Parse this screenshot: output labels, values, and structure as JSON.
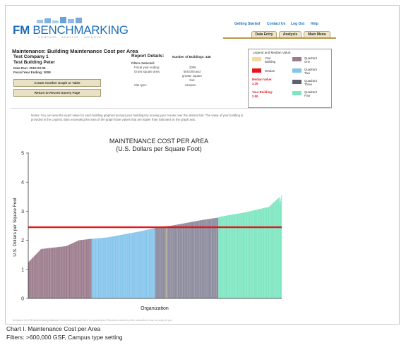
{
  "brand": {
    "fm": "FM",
    "benchmarking": "BENCHMARKING",
    "tagline": "COMPARE · ANALYZE · IMPROVE"
  },
  "topnav": [
    "Getting Started",
    "Contact Us",
    "Log Out",
    "Help"
  ],
  "tabs": [
    "Data Entry",
    "Analysis",
    "Main Menu"
  ],
  "page_title": "Maintenance: Building Maintenance Cost per Area",
  "company": "Test Company 1",
  "building": "Test Building Peter",
  "date_run": "Date Run: 2010-03-09",
  "fiscal_year": "Fiscal Year Ending: 2008",
  "buttons": {
    "create": "Create Another Graph or Table",
    "return": "Return to Recent Survey Page"
  },
  "report": {
    "title": "Report Details:",
    "num_buildings": "Number of Buildings: 448",
    "filters_label": "Filters Selected:",
    "f1_label": "Fiscal year ending:",
    "f1_value": "2008",
    "f2_label": "Gross square area:",
    "f2_value_a": "600,000 and",
    "f2_value_b": "greater square",
    "f2_value_c": "feet",
    "f3_label": "Site type:",
    "f3_value": "campus"
  },
  "legend": {
    "title": "Legend and Median Value:",
    "your_building_a": "Your",
    "your_building_b": "Building",
    "median": "Median",
    "q1_a": "Quadrant",
    "q1_b": "One",
    "q2_a": "Quadrant",
    "q2_b": "Two",
    "q3_a": "Quadrant",
    "q3_b": "Three",
    "q4_a": "Quadrant",
    "q4_b": "Four",
    "median_value_label": "Median Value:",
    "median_value": "2.45",
    "your_building_value_label": "Your Building:",
    "your_building_value": "2.50",
    "colors": {
      "your": "#f3d9a0",
      "median": "#e8141c",
      "q1": "#9b7b8c",
      "q2": "#85c5ec",
      "q3": "#7b7b8c",
      "q4": "#7de6c1"
    }
  },
  "notes": "Notes: You can view the exact value for each building graphed (except your building) by moving your mouse over the desired bar. The value of your building is provided in the Legend. Bars exceeding the area of the graph have values that are higher than indicated on the graph axis.",
  "chart_data": {
    "type": "bar",
    "title": "MAINTENANCE COST PER AREA",
    "subtitle": "(U.S. Dollars per Square Foot)",
    "xlabel": "Organization",
    "ylabel": "U.S. Dollars per Square Foot",
    "ylim": [
      0,
      5
    ],
    "yticks": [
      "0",
      "1",
      "2",
      "3",
      "4",
      "5"
    ],
    "median": 2.45,
    "your_building": 2.5,
    "n": 448,
    "quartile_values": {
      "q1": [
        1.25,
        1.7,
        1.75,
        1.8,
        2.0,
        2.05
      ],
      "q2": [
        2.05,
        2.1,
        2.2,
        2.3,
        2.42
      ],
      "q3": [
        2.45,
        2.5,
        2.6,
        2.7,
        2.78
      ],
      "q4": [
        2.8,
        2.88,
        2.95,
        3.05,
        3.15,
        3.55
      ]
    },
    "grid": false
  },
  "footnote": "All data in the FM Benchmarking database is believed accurate but is not guaranteed. Results provided by other subscribers may not apply to you.",
  "caption1": "Chart I.  Maintenance Cost per Area",
  "caption2": "Filters: >600,000 GSF, Campus type setting"
}
